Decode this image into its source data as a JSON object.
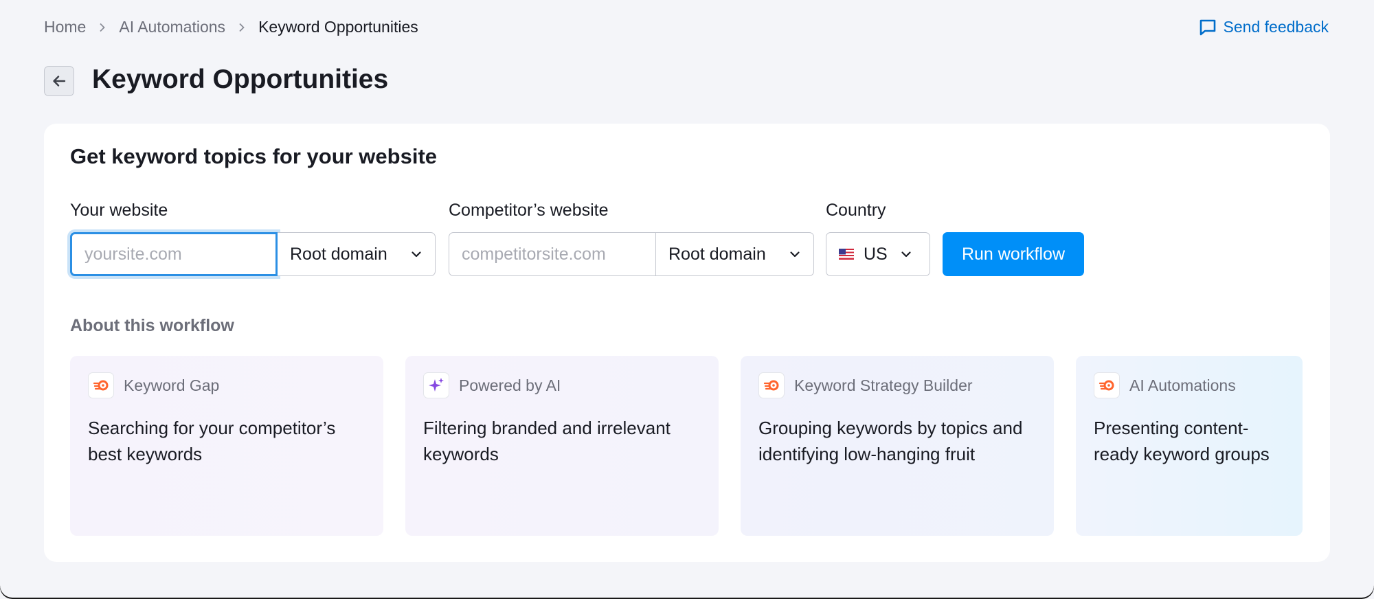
{
  "breadcrumb": {
    "items": [
      "Home",
      "AI Automations",
      "Keyword Opportunities"
    ]
  },
  "feedback": {
    "label": "Send feedback"
  },
  "header": {
    "title": "Keyword Opportunities"
  },
  "form": {
    "title": "Get keyword topics for your website",
    "your_website": {
      "label": "Your website",
      "placeholder": "yoursite.com",
      "value": "",
      "scope": "Root domain"
    },
    "competitor_website": {
      "label": "Competitor’s website",
      "placeholder": "competitorsite.com",
      "value": "",
      "scope": "Root domain"
    },
    "country": {
      "label": "Country",
      "value": "US"
    },
    "run_label": "Run workflow"
  },
  "about": {
    "title": "About this workflow",
    "steps": [
      {
        "source": "Keyword Gap",
        "icon": "semrush-logo-icon",
        "text": "Searching for your competitor’s best keywords"
      },
      {
        "source": "Powered by AI",
        "icon": "ai-sparkle-icon",
        "text": "Filtering branded and irrelevant keywords"
      },
      {
        "source": "Keyword Strategy Builder",
        "icon": "semrush-logo-icon",
        "text": "Grouping keywords by topics and identifying low-hanging fruit"
      },
      {
        "source": "AI Automations",
        "icon": "semrush-logo-icon",
        "text": "Presenting content-ready keyword groups"
      }
    ]
  },
  "colors": {
    "accent": "#008ff8",
    "link": "#006dca",
    "background": "#f4f5f9"
  }
}
